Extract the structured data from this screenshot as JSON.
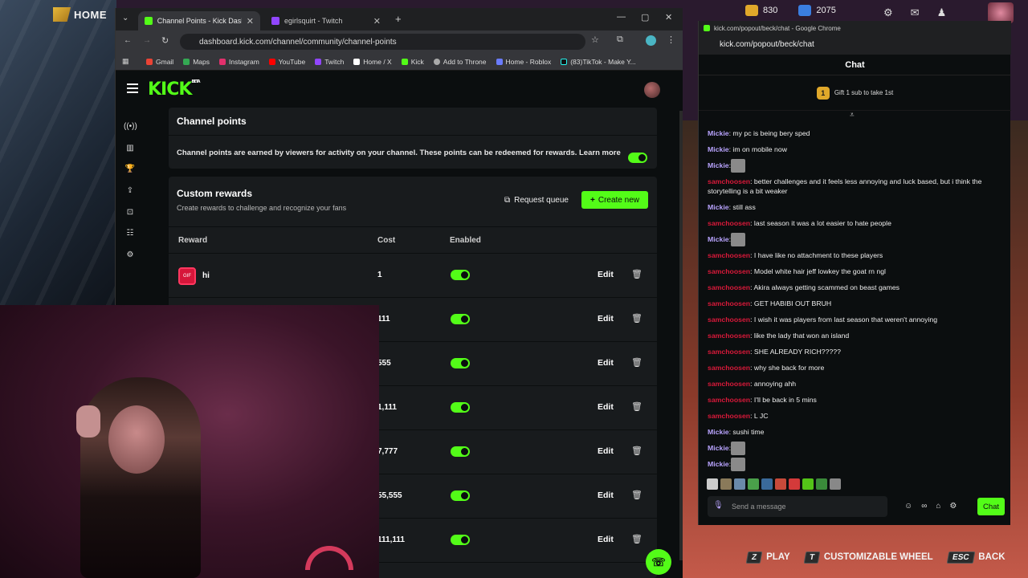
{
  "game": {
    "title": "HOME",
    "currency1": "830",
    "currency2": "2075",
    "controls": [
      {
        "key": "Z",
        "label": "PLAY"
      },
      {
        "key": "T",
        "label": "CUSTOMIZABLE WHEEL"
      },
      {
        "key": "ESC",
        "label": "BACK"
      }
    ]
  },
  "browser": {
    "tabs": [
      {
        "label": "Channel Points - Kick Dashboard"
      },
      {
        "label": "egirlsquirt - Twitch"
      }
    ],
    "url": "dashboard.kick.com/channel/community/channel-points",
    "bookmarks": [
      "Gmail",
      "Maps",
      "Instagram",
      "YouTube",
      "Twitch",
      "Home / X",
      "Kick",
      "Add to Throne",
      "Home - Roblox",
      "(83)TikTok - Make Y..."
    ]
  },
  "kick": {
    "logo": "KICK",
    "logo_badge": "BETA",
    "channel_points": {
      "title": "Channel points",
      "description": "Channel points are earned by viewers for activity on your channel. These points can be redeemed for rewards. Learn more",
      "enabled": true
    },
    "custom_rewards": {
      "title": "Custom rewards",
      "subtitle": "Create rewards to challenge and recognize your fans",
      "request_queue": "Request queue",
      "create_new": "Create new",
      "headers": {
        "reward": "Reward",
        "cost": "Cost",
        "enabled": "Enabled"
      },
      "rows": [
        {
          "name": "hi",
          "cost": "1",
          "edit": "Edit"
        },
        {
          "name": "",
          "cost": "111",
          "edit": "Edit"
        },
        {
          "name": "",
          "cost": "555",
          "edit": "Edit"
        },
        {
          "name": "",
          "cost": "1,111",
          "edit": "Edit"
        },
        {
          "name": "",
          "cost": "7,777",
          "edit": "Edit"
        },
        {
          "name": "",
          "cost": "55,555",
          "edit": "Edit"
        },
        {
          "name": "",
          "cost": "111,111",
          "edit": "Edit"
        }
      ]
    }
  },
  "chat": {
    "window_title": "kick.com/popout/beck/chat - Google Chrome",
    "url": "kick.com/popout/beck/chat",
    "header": "Chat",
    "gift": "Gift 1 sub to take 1st",
    "gift_rank": "1",
    "input_placeholder": "Send a message",
    "send_label": "Chat",
    "messages": [
      {
        "user": "Mickie",
        "text": ": my pc is being bery sped"
      },
      {
        "user": "Mickie",
        "text": ": im on mobile now"
      },
      {
        "user": "Mickie",
        "text": ":",
        "emote": true
      },
      {
        "user": "samchoosen",
        "text": ": better challenges and it feels less annoying and luck based, but i think the storytelling is a bit weaker",
        "wrap": true
      },
      {
        "user": "Mickie",
        "text": ": still ass"
      },
      {
        "user": "samchoosen",
        "text": ": last season it was a lot easier to hate people"
      },
      {
        "user": "Mickie",
        "text": ":",
        "emote": true
      },
      {
        "user": "samchoosen",
        "text": ": I have like no attachment to these players"
      },
      {
        "user": "samchoosen",
        "text": ": Model white hair jeff lowkey the goat rn ngl"
      },
      {
        "user": "samchoosen",
        "text": ": Akira always getting scammed on beast games"
      },
      {
        "user": "samchoosen",
        "text": ": GET HABIBI OUT BRUH"
      },
      {
        "user": "samchoosen",
        "text": ": I wish it was players from last season that weren't annoying"
      },
      {
        "user": "samchoosen",
        "text": ": like the lady that won an island"
      },
      {
        "user": "samchoosen",
        "text": ": SHE ALREADY RICH?????"
      },
      {
        "user": "samchoosen",
        "text": ": why she back for more"
      },
      {
        "user": "samchoosen",
        "text": ": annoying ahh"
      },
      {
        "user": "samchoosen",
        "text": ": I'll be back in 5 mins"
      },
      {
        "user": "samchoosen",
        "text": ": L JC"
      },
      {
        "user": "Mickie",
        "text": ": sushi time"
      },
      {
        "user": "Mickie",
        "text": ":",
        "emote": true
      },
      {
        "user": "Mickie",
        "text": ":",
        "emote": true
      }
    ]
  },
  "colors": {
    "kick_green": "#53fc18",
    "mod_red": "#d9193a",
    "mickie_purple": "#b9a4ff"
  }
}
